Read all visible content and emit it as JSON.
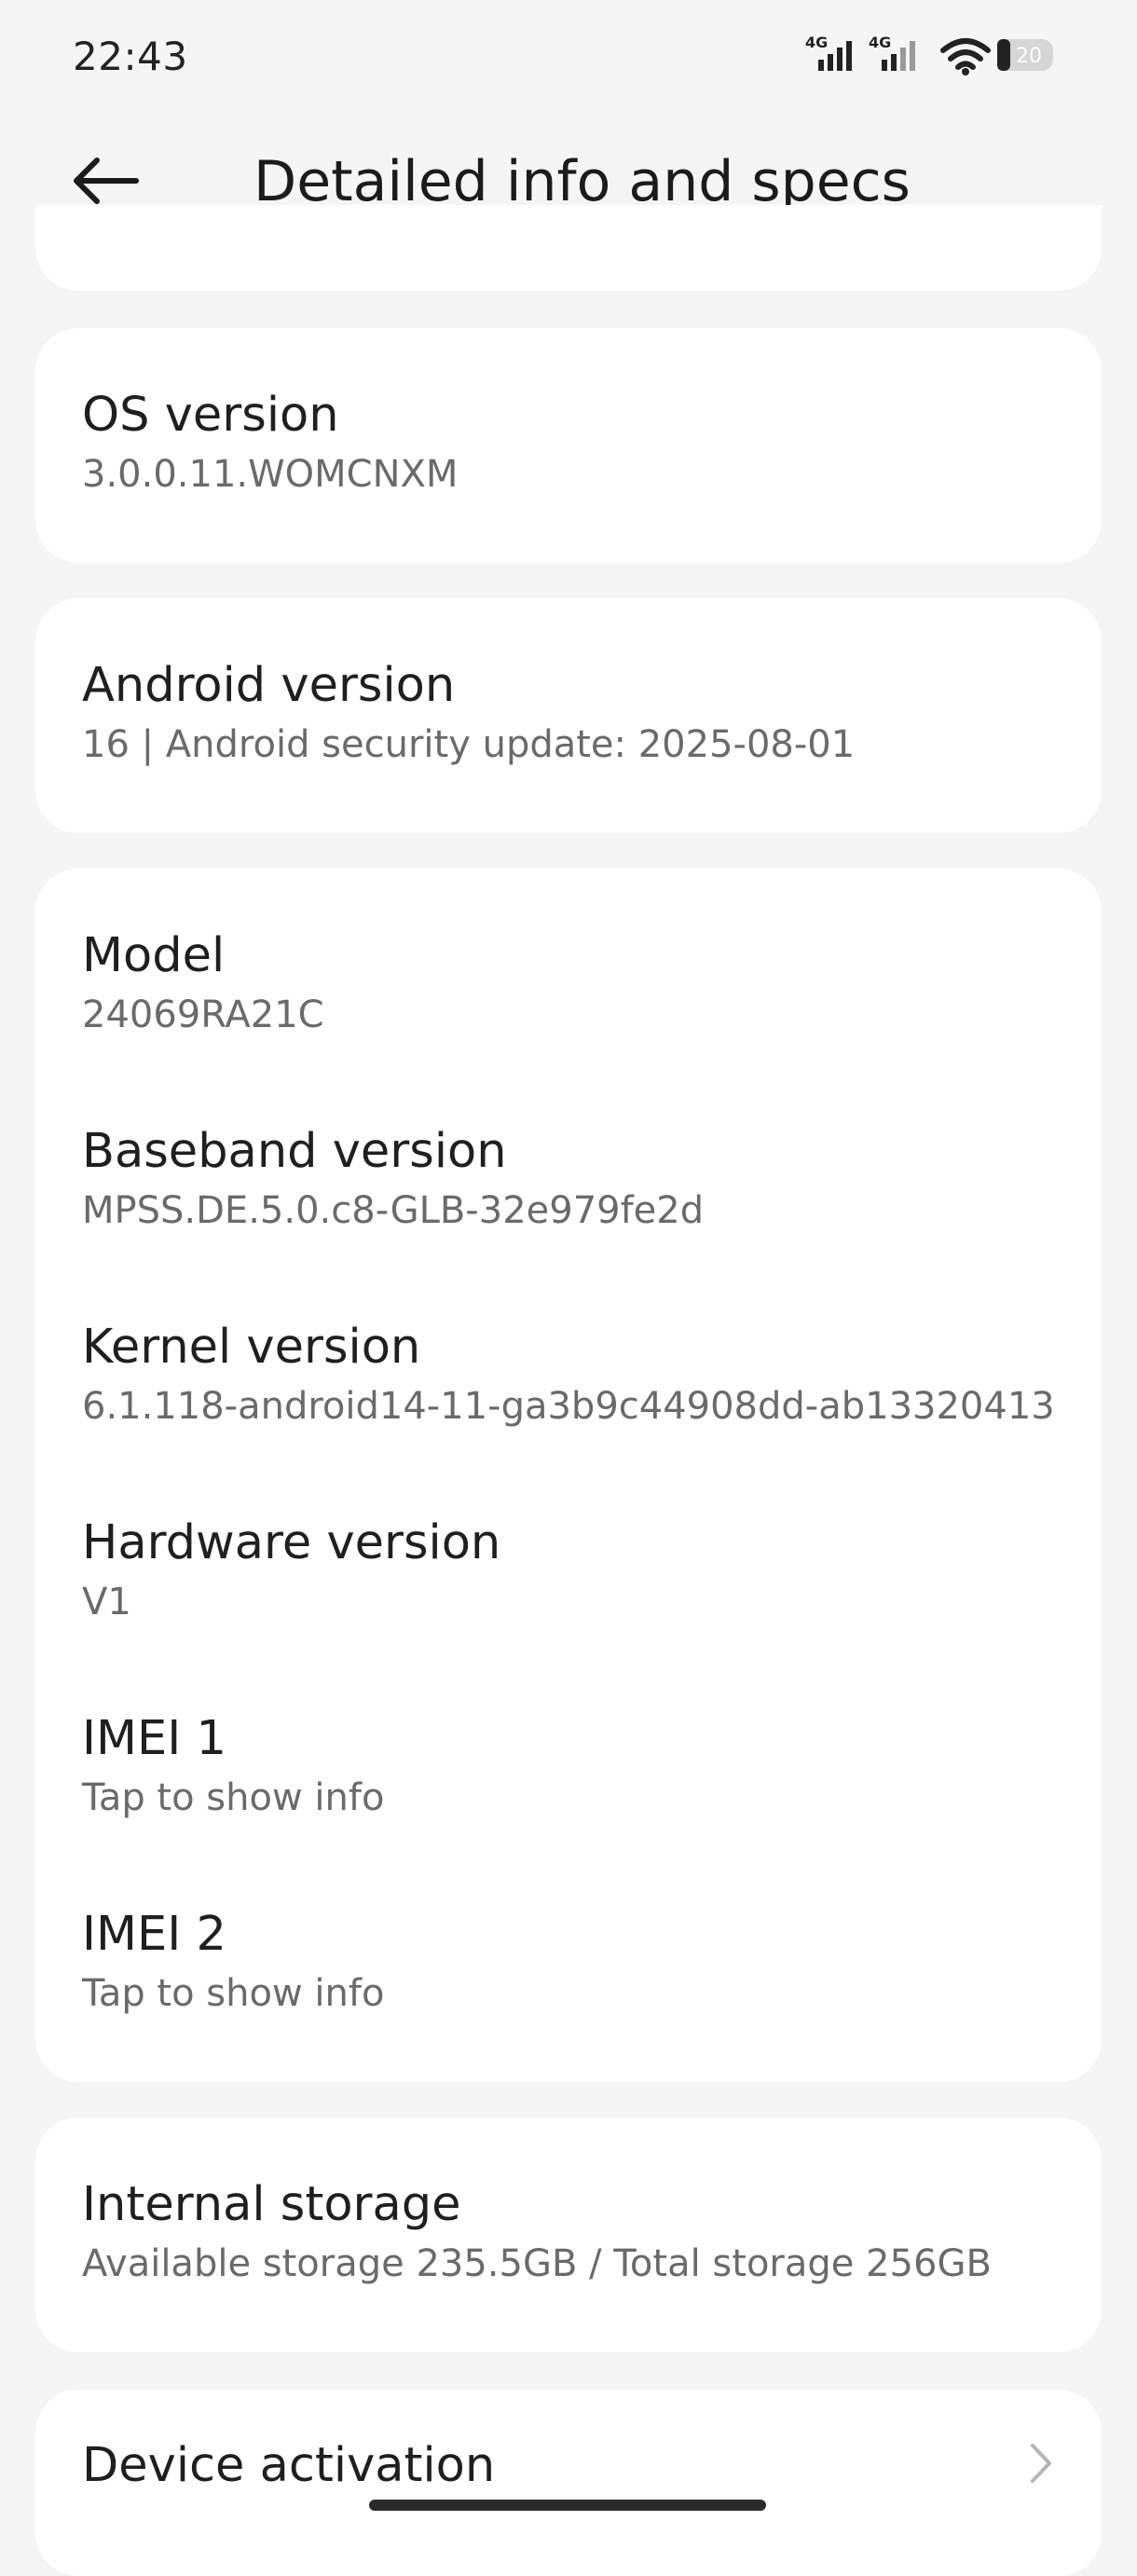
{
  "status_bar": {
    "time": "22:43",
    "network_1": "4G",
    "network_2": "4G",
    "battery": "20"
  },
  "header": {
    "title": "Detailed info and specs"
  },
  "cards": {
    "os": {
      "title": "OS version",
      "value": "3.0.0.11.WOMCNXM"
    },
    "android": {
      "title": "Android version",
      "value": "16 | Android security update: 2025-08-01"
    },
    "device": {
      "items": [
        {
          "title": "Model",
          "value": "24069RA21C"
        },
        {
          "title": "Baseband version",
          "value": "MPSS.DE.5.0.c8-GLB-32e979fe2d"
        },
        {
          "title": "Kernel version",
          "value": "6.1.118-android14-11-ga3b9c44908dd-ab13320413"
        },
        {
          "title": "Hardware version",
          "value": "V1"
        },
        {
          "title": "IMEI 1",
          "value": "Tap to show info"
        },
        {
          "title": "IMEI 2",
          "value": "Tap to show info"
        }
      ]
    },
    "storage": {
      "title": "Internal storage",
      "value": "Available storage  235.5GB / Total storage  256GB"
    },
    "activation": {
      "title": "Device activation"
    }
  },
  "icons": {
    "back": "back-arrow-icon",
    "chevron": "chevron-right-icon"
  }
}
